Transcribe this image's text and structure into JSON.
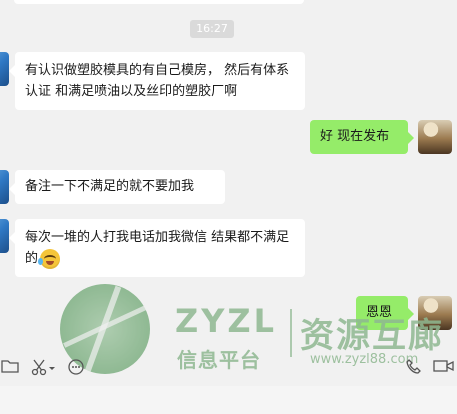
{
  "timestamp": "16:27",
  "messages": [
    {
      "side": "in",
      "text": "有认识做塑胶模具的有自己模房， 然后有体系认证  和满足喷油以及丝印的塑胶厂啊"
    },
    {
      "side": "out",
      "text": "好 现在发布"
    },
    {
      "side": "in",
      "text": "备注一下不满足的就不要加我"
    },
    {
      "side": "in",
      "text": "每次一堆的人打我电话加我微信 结果都不满足的",
      "emoji": "crying-laughing"
    },
    {
      "side": "out",
      "text": "恩恩"
    }
  ],
  "watermark": {
    "brand": "ZYZL",
    "brand_cn": "资源互廊",
    "sub": "信息平台",
    "url": "www.zyzl88.com"
  },
  "toolbar": {
    "icons": [
      "folder-icon",
      "scissors-icon",
      "chat-history-icon",
      "phone-icon",
      "video-icon"
    ]
  },
  "colors": {
    "incoming": "#ffffff",
    "outgoing": "#95ec69",
    "background": "#f1f1f1"
  }
}
